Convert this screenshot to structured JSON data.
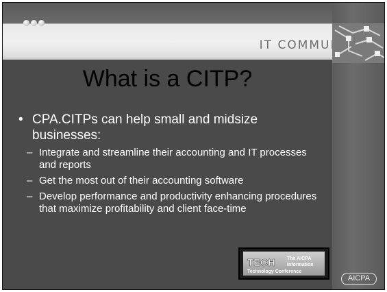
{
  "header": {
    "section_title": "IT COMMUNITY"
  },
  "slide": {
    "title": "What is a CITP?",
    "bullet": "CPA.CITPs can help small and midsize businesses:",
    "subpoints": [
      "Integrate and streamline their accounting and IT processes and reports",
      "Get the most out of their accounting software",
      "Develop performance and productivity enhancing procedures that maximize profitability and client face-time"
    ]
  },
  "logos": {
    "tech_word": "TECH",
    "tech_text_line1": "The AICPA",
    "tech_text_line2": "Information",
    "tech_text_line3": "Technology Conference",
    "aicpa": "AICPA"
  },
  "colors": {
    "background": "#4a4a4a",
    "header": "#eeeeee",
    "title": "#000000",
    "body_text": "#ffffff"
  }
}
